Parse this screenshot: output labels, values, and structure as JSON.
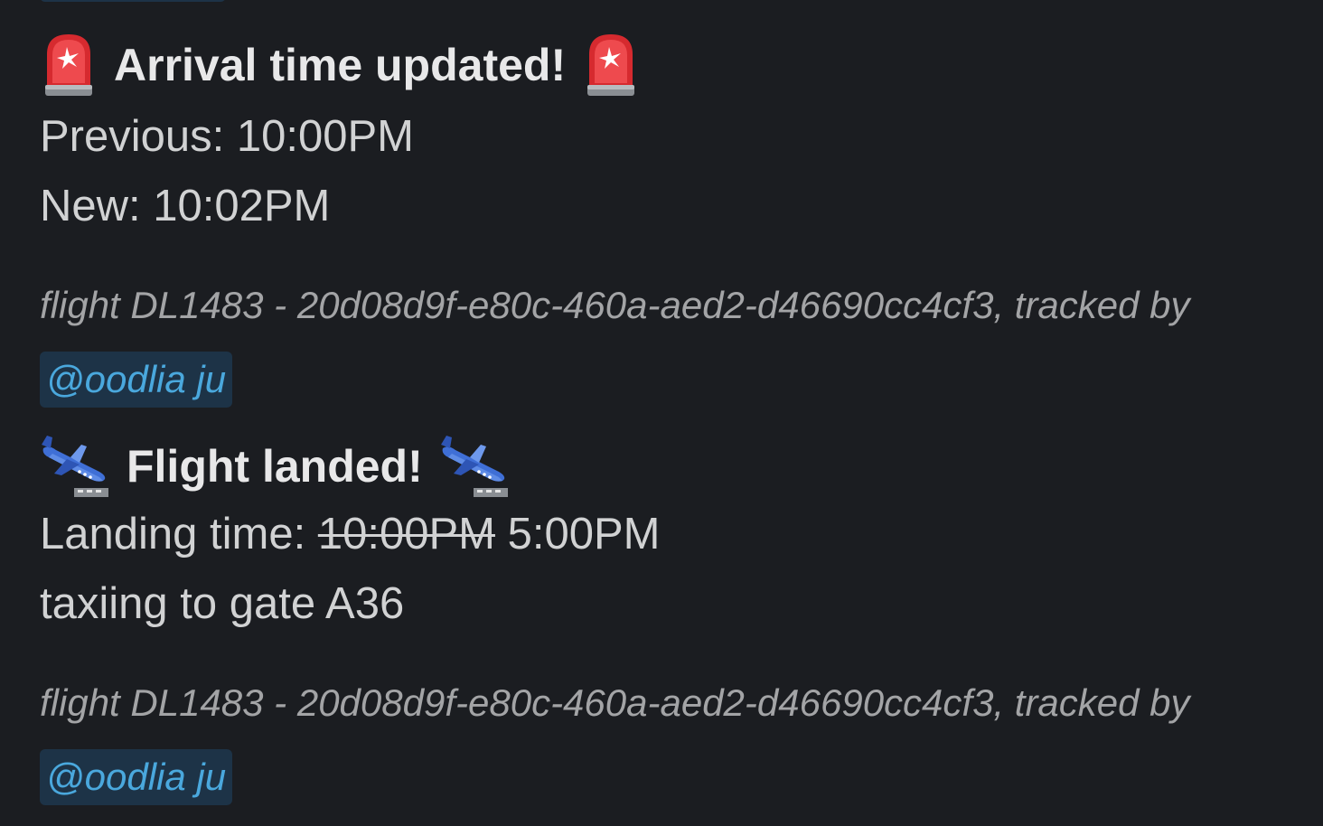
{
  "messages": [
    {
      "heading": "Arrival time updated!",
      "icon": "rotating-light-icon",
      "lines": {
        "previous": "Previous: 10:00PM",
        "new": "New: 10:02PM"
      },
      "footer": "flight DL1483 - 20d08d9f-e80c-460a-aed2-d46690cc4cf3, tracked by",
      "mention": "@oodlia ju"
    },
    {
      "heading": "Flight landed!",
      "icon": "airplane-arriving-icon",
      "landing_label": "Landing time:",
      "old_time": "10:00PM",
      "new_time": "5:00PM",
      "status": "taxiing to gate A36",
      "footer": "flight DL1483 - 20d08d9f-e80c-460a-aed2-d46690cc4cf3, tracked by",
      "mention": "@oodlia ju"
    }
  ],
  "colors": {
    "background": "#1b1d21",
    "text": "#d1d2d3",
    "muted": "#a3a4a6",
    "mention_bg": "#1d3347",
    "mention_text": "#4aa8dd",
    "siren_red": "#e0353a"
  }
}
